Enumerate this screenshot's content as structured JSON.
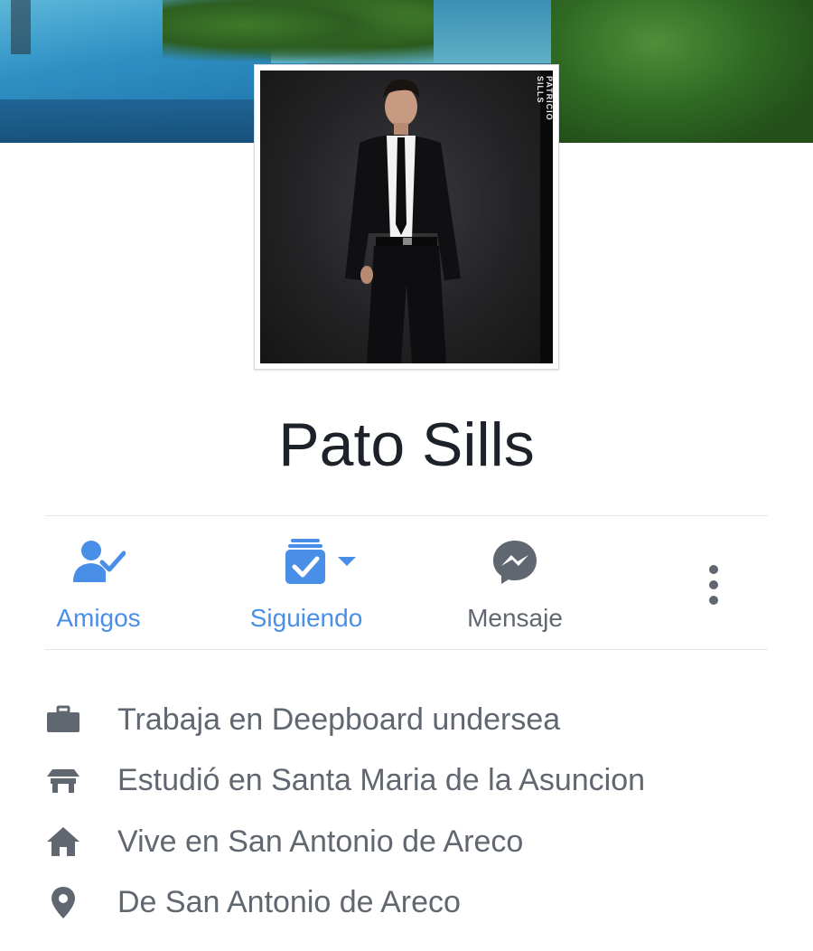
{
  "profile": {
    "name": "Pato Sills",
    "photo_watermark": "PATRICIO SILLS"
  },
  "actions": [
    {
      "label": "Amigos",
      "icon": "friends-check-icon",
      "color": "#4a8fe7"
    },
    {
      "label": "Siguiendo",
      "icon": "following-icon",
      "color": "#4a8fe7"
    },
    {
      "label": "Mensaje",
      "icon": "messenger-icon",
      "color": "#606770"
    },
    {
      "label": "",
      "icon": "more-vertical-icon",
      "color": "#606770"
    }
  ],
  "intro": [
    {
      "icon": "briefcase-icon",
      "text": "Trabaja en Deepboard undersea"
    },
    {
      "icon": "school-icon",
      "text": "Estudió en Santa Maria de la Asuncion"
    },
    {
      "icon": "home-icon",
      "text": "Vive en San Antonio de Areco"
    },
    {
      "icon": "location-pin-icon",
      "text": "De San Antonio de Areco"
    }
  ],
  "colors": {
    "accent_blue": "#4a8fe7",
    "text_gray": "#606770",
    "name_text": "#1d2129",
    "divider": "#e5e6e9"
  }
}
